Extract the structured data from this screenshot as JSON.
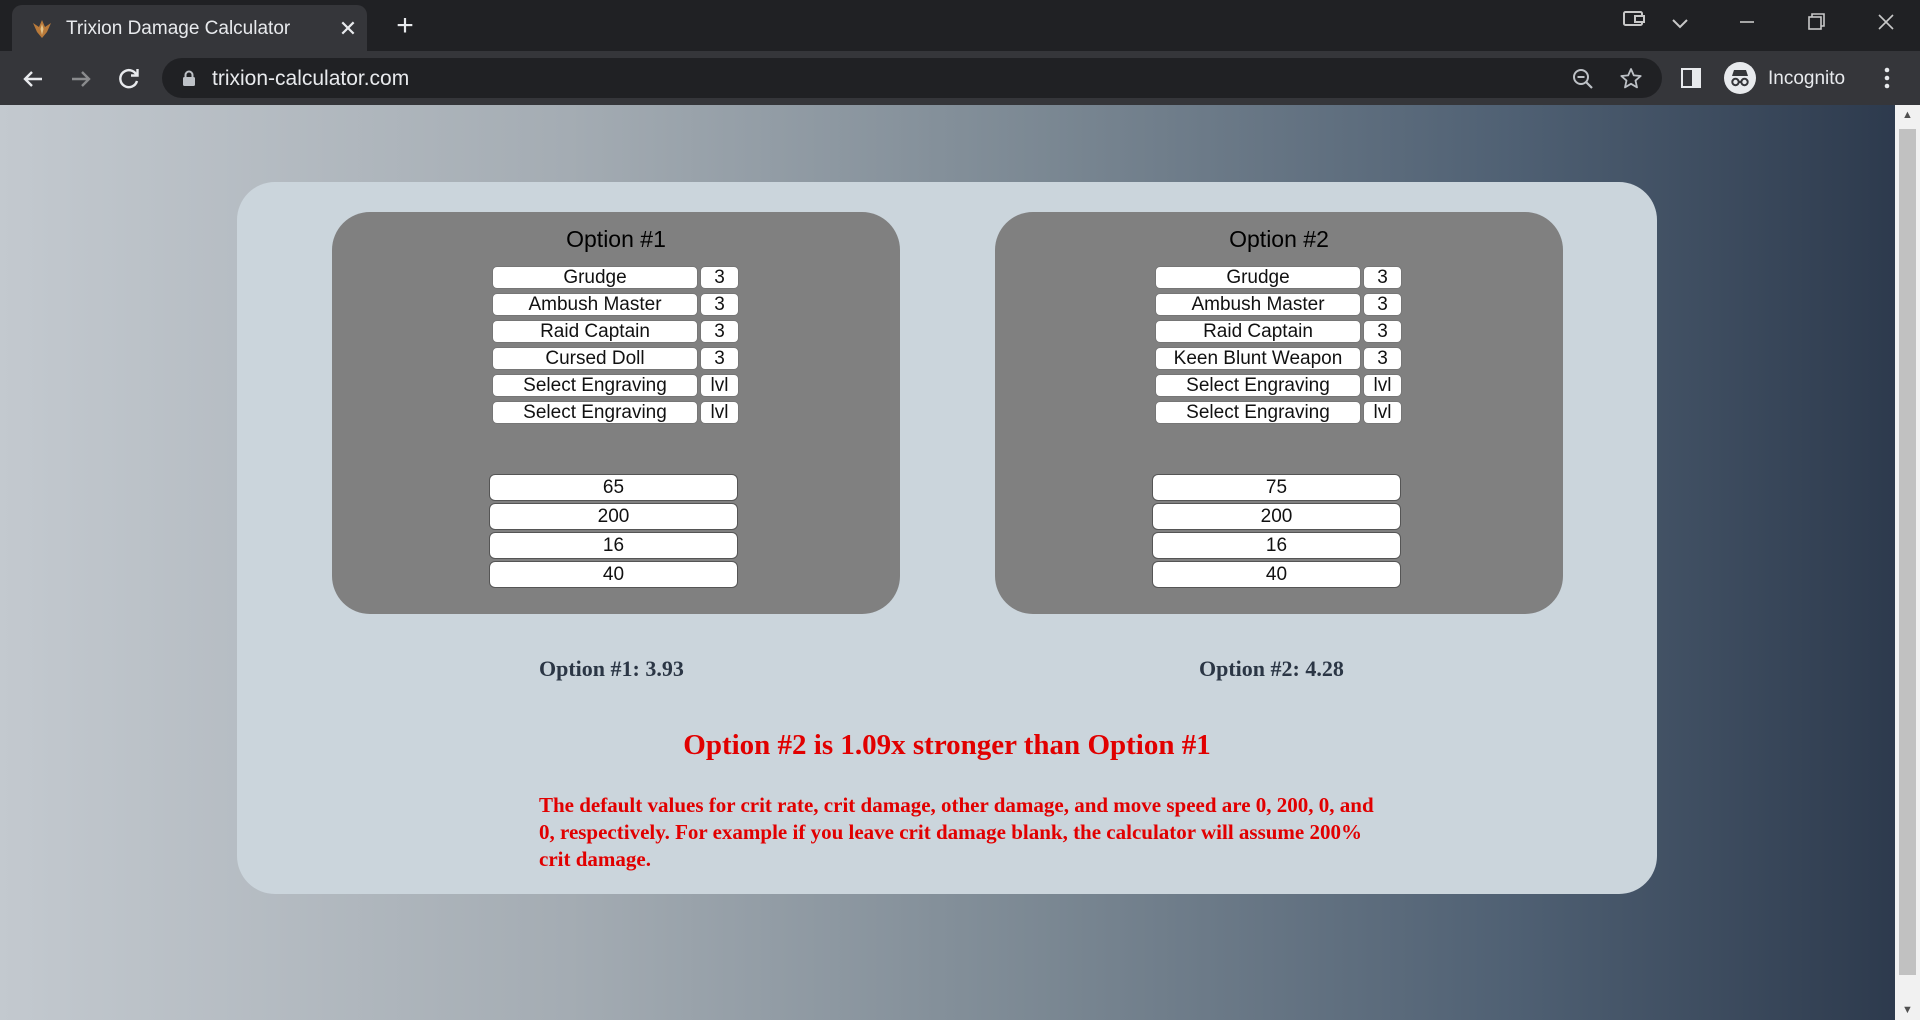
{
  "browser": {
    "tab_title": "Trixion Damage Calculator",
    "url": "trixion-calculator.com",
    "profile_label": "Incognito"
  },
  "options": [
    {
      "title": "Option #1",
      "engravings": [
        {
          "name": "Grudge",
          "level": "3"
        },
        {
          "name": "Ambush Master",
          "level": "3"
        },
        {
          "name": "Raid Captain",
          "level": "3"
        },
        {
          "name": "Cursed Doll",
          "level": "3"
        },
        {
          "name": "Select Engraving",
          "level": "lvl"
        },
        {
          "name": "Select Engraving",
          "level": "lvl"
        }
      ],
      "stats": [
        "65",
        "200",
        "16",
        "40"
      ],
      "result": "Option #1: 3.93"
    },
    {
      "title": "Option #2",
      "engravings": [
        {
          "name": "Grudge",
          "level": "3"
        },
        {
          "name": "Ambush Master",
          "level": "3"
        },
        {
          "name": "Raid Captain",
          "level": "3"
        },
        {
          "name": "Keen Blunt Weapon",
          "level": "3"
        },
        {
          "name": "Select Engraving",
          "level": "lvl"
        },
        {
          "name": "Select Engraving",
          "level": "lvl"
        }
      ],
      "stats": [
        "75",
        "200",
        "16",
        "40"
      ],
      "result": "Option #2: 4.28"
    }
  ],
  "verdict": "Option #2 is 1.09x stronger than Option #1",
  "note": "The default values for crit rate, crit damage, other damage, and move speed are 0, 200, 0, and 0, respectively. For example if you leave crit damage blank, the calculator will assume 200% crit damage.",
  "colors": {
    "card": "#cbd5dc",
    "panel": "#808080",
    "result_text": "#2b3645",
    "alert_text": "#e10000"
  }
}
